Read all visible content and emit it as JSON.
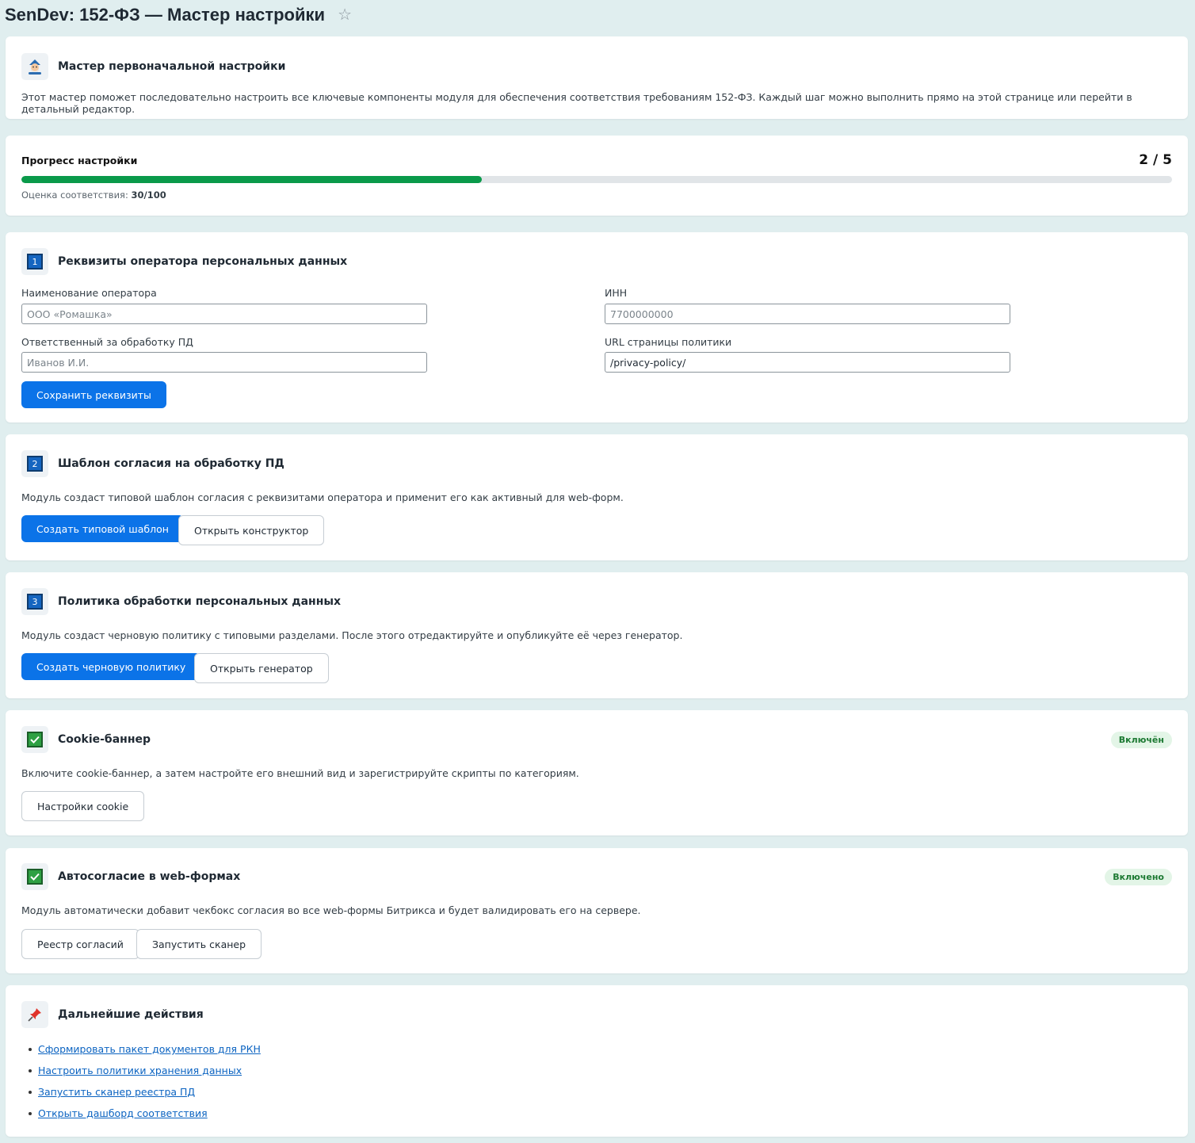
{
  "page": {
    "title": "SenDev: 152-ФЗ — Мастер настройки",
    "favorite_icon": "star-icon"
  },
  "intro": {
    "icon": "wizard-icon",
    "title": "Мастер первоначальной настройки",
    "description": "Этот мастер поможет последовательно настроить все ключевые компоненты модуля для обеспечения соответствия требованиям 152-ФЗ. Каждый шаг можно выполнить прямо на этой странице или перейти в детальный редактор."
  },
  "progress": {
    "label": "Прогресс настройки",
    "counter": "2 / 5",
    "completed": 2,
    "total": 5,
    "score_label": "Оценка соответствия:",
    "score_value": "30/100",
    "fill_color": "#0a9a4a"
  },
  "step1": {
    "number": "1",
    "title": "Реквизиты оператора персональных данных",
    "operator_label": "Наименование оператора",
    "operator_placeholder": "ООО «Ромашка»",
    "operator_value": "",
    "inn_label": "ИНН",
    "inn_placeholder": "7700000000",
    "inn_value": "",
    "responsible_label": "Ответственный за обработку ПД",
    "responsible_placeholder": "Иванов И.И.",
    "responsible_value": "",
    "policy_url_label": "URL страницы политики",
    "policy_url_value": "/privacy-policy/",
    "save_button": "Сохранить реквизиты"
  },
  "step2": {
    "number": "2",
    "title": "Шаблон согласия на обработку ПД",
    "description": "Модуль создаст типовой шаблон согласия с реквизитами оператора и применит его как активный для web-форм.",
    "primary_button": "Создать типовой шаблон",
    "secondary_button": "Открыть конструктор"
  },
  "step3": {
    "number": "3",
    "title": "Политика обработки персональных данных",
    "description": "Модуль создаст черновую политику с типовыми разделами. После этого отредактируйте и опубликуйте её через генератор.",
    "primary_button": "Создать черновую политику",
    "secondary_button": "Открыть генератор"
  },
  "step4": {
    "icon": "check-icon",
    "title": "Cookie-баннер",
    "status": "Включён",
    "description": "Включите cookie-баннер, а затем настройте его внешний вид и зарегистрируйте скрипты по категориям.",
    "button": "Настройки cookie"
  },
  "step5": {
    "icon": "check-icon",
    "title": "Автосогласие в web-формах",
    "status": "Включено",
    "description": "Модуль автоматически добавит чекбокс согласия во все web-формы Битрикса и будет валидировать его на сервере.",
    "button1": "Реестр согласий",
    "button2": "Запустить сканер"
  },
  "next": {
    "icon": "pin-icon",
    "title": "Дальнейшие действия",
    "links": [
      "Сформировать пакет документов для РКН",
      "Настроить политики хранения данных",
      "Запустить сканер реестра ПД",
      "Открыть дашборд соответствия"
    ]
  },
  "colors": {
    "accent": "#0b73e8",
    "success": "#2ea043",
    "background": "#e0eeef"
  }
}
